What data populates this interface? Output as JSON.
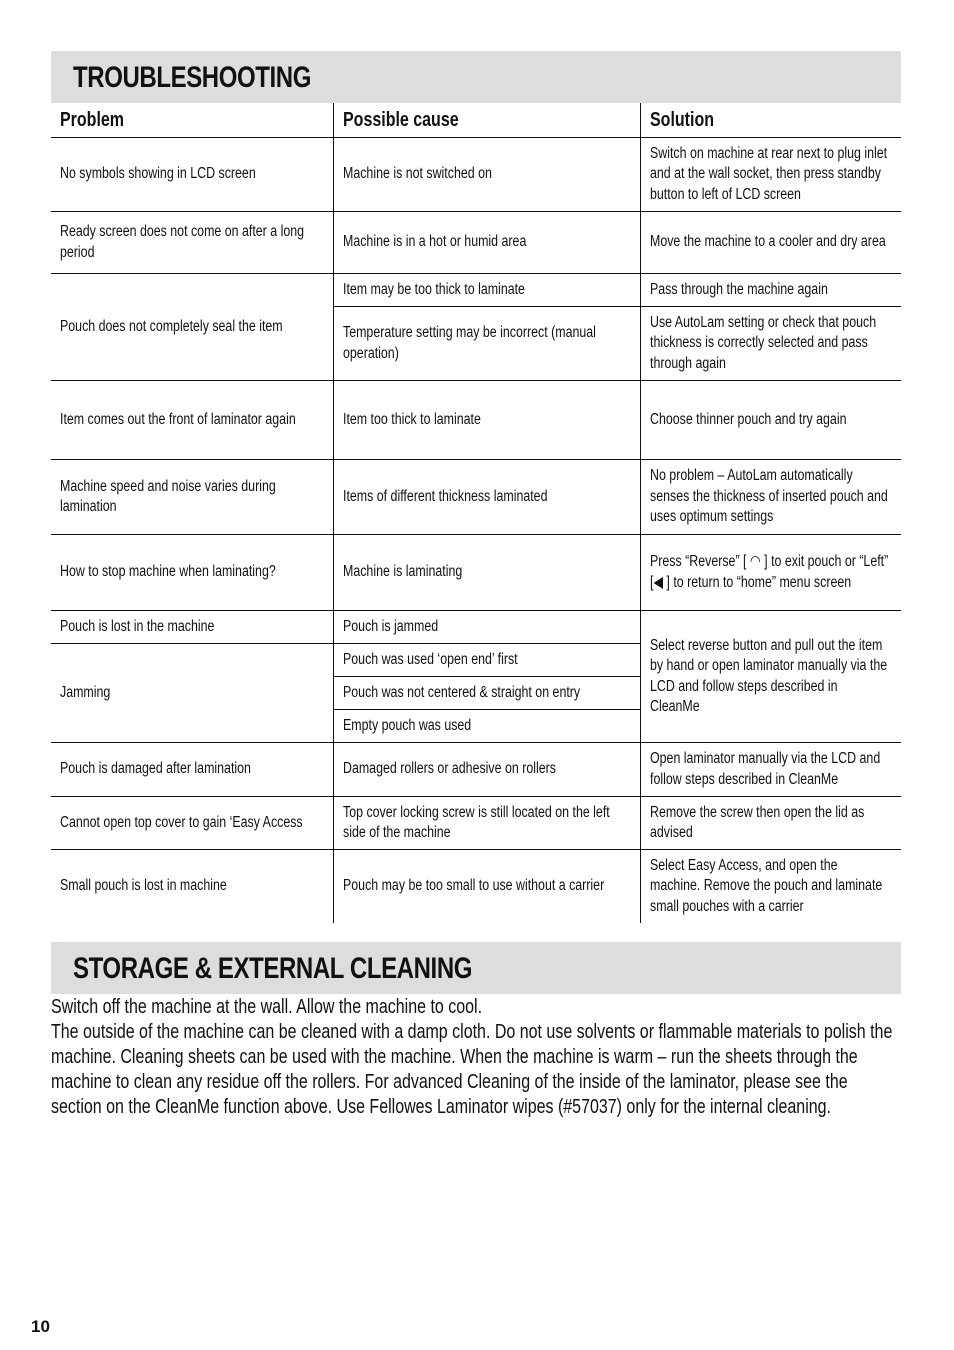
{
  "troubleshooting": {
    "title": "TROUBLESHOOTING",
    "headers": [
      "Problem",
      "Possible cause",
      "Solution"
    ],
    "rows": [
      {
        "problem": "No symbols showing in LCD screen",
        "cause": "Machine is not switched on",
        "solution": "Switch on machine at rear next to plug inlet and at the wall socket, then press standby button to left of LCD screen"
      },
      {
        "problem": "Ready screen does not come on after a long period",
        "cause": "Machine is in a hot or humid area",
        "solution": "Move the machine to a cooler and dry area"
      },
      {
        "problem": "Pouch does not completely seal the item",
        "cause": "Item may be too thick to laminate",
        "solution": "Pass through the machine again"
      },
      {
        "cause": "Temperature setting may be incorrect (manual operation)",
        "solution": "Use AutoLam setting or check that pouch thickness is correctly selected and pass through again"
      },
      {
        "problem": "Item comes out the front of laminator again",
        "cause": "Item too thick to laminate",
        "solution": "Choose thinner pouch and try again"
      },
      {
        "problem": "Machine speed and noise varies during lamination",
        "cause": "Items of different thickness laminated",
        "solution": "No problem – AutoLam automatically senses the thickness of inserted pouch and uses optimum settings"
      },
      {
        "problem": "How to stop machine when laminating?",
        "cause": "Machine is laminating",
        "solution": "Press “Reverse” [ ◠ ] to exit pouch or “Left” [◀ ] to return to “home” menu screen"
      },
      {
        "problem": "Pouch is lost in the machine",
        "cause": "Pouch is jammed",
        "solution": "Select reverse button and pull out the item by hand or open laminator manually via the LCD and follow steps described in CleanMe"
      },
      {
        "problem": "Jamming",
        "cause": "Pouch was used ‘open end’ first"
      },
      {
        "cause": "Pouch was not centered & straight on entry"
      },
      {
        "cause": "Empty pouch was used"
      },
      {
        "problem": "Pouch is damaged after lamination",
        "cause": "Damaged rollers or adhesive on rollers",
        "solution": "Open laminator manually via the LCD and follow steps described in CleanMe"
      },
      {
        "problem": "Cannot open top cover to gain ‘Easy Access",
        "cause": "Top cover locking screw is still located on the left side of the machine",
        "solution": "Remove the screw then open the lid as advised"
      },
      {
        "problem": "Small pouch is lost in machine",
        "cause": "Pouch may be  too small to use without a carrier",
        "solution": "Select Easy Access, and open the machine. Remove the pouch and laminate small pouches with a carrier"
      }
    ]
  },
  "storage": {
    "title": "STORAGE & EXTERNAL CLEANING",
    "lines": [
      "Switch off the machine at the wall. Allow the machine to cool.",
      "The outside of the machine can be cleaned with a damp cloth. Do not use solvents or flammable materials to polish the machine. Cleaning sheets can be used with the machine. When the machine is warm – run the sheets through the machine to clean any residue off the rollers. For advanced Cleaning of the inside of the laminator, please see the section on the CleanMe function above. Use Fellowes Laminator wipes (#57037) only for the internal cleaning."
    ]
  },
  "page_number": "10"
}
